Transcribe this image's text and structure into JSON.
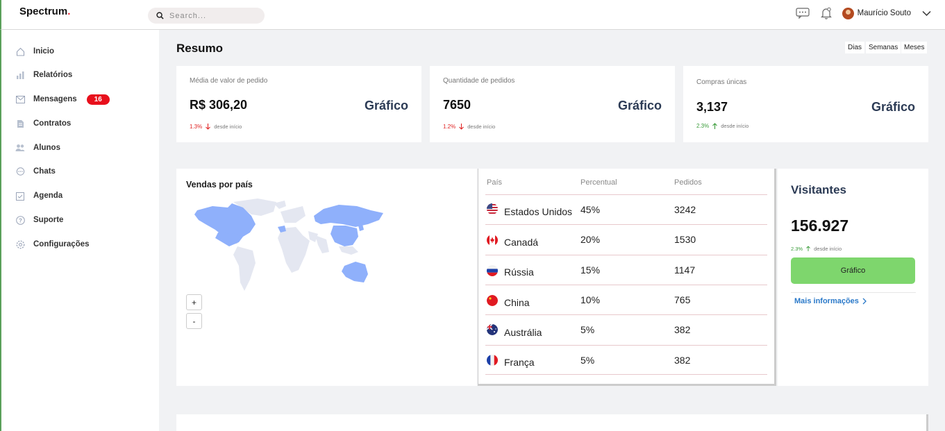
{
  "app": {
    "logo": "Spectrum",
    "logo_dot": "."
  },
  "search": {
    "placeholder": "Search..."
  },
  "user": {
    "name": "Maurício Souto"
  },
  "sidebar": {
    "items": [
      {
        "label": "Inicio",
        "icon": "home-icon"
      },
      {
        "label": "Relatórios",
        "icon": "chart-icon"
      },
      {
        "label": "Mensagens",
        "icon": "mail-icon",
        "badge": "16"
      },
      {
        "label": "Contratos",
        "icon": "document-icon"
      },
      {
        "label": "Alunos",
        "icon": "users-icon"
      },
      {
        "label": "Chats",
        "icon": "chat-icon"
      },
      {
        "label": "Agenda",
        "icon": "calendar-icon"
      },
      {
        "label": "Suporte",
        "icon": "help-icon"
      },
      {
        "label": "Configurações",
        "icon": "settings-icon"
      }
    ]
  },
  "main": {
    "title": "Resumo",
    "ranges": [
      "Dias",
      "Semanas",
      "Meses"
    ],
    "kpis": [
      {
        "label": "Média de valor de pedido",
        "value": "R$ 306,20",
        "link": "Gráfico",
        "change": "1.3%",
        "direction": "down",
        "since": "desde início"
      },
      {
        "label": "Quantidade de pedidos",
        "value": "7650",
        "link": "Gráfico",
        "change": "1.2%",
        "direction": "down",
        "since": "desde início"
      },
      {
        "label": "Compras únicas",
        "value": "3,137",
        "link": "Gráfico",
        "change": "2.3%",
        "direction": "up",
        "since": "desde início"
      }
    ]
  },
  "map": {
    "title": "Vendas por país",
    "zoom_in": "+",
    "zoom_out": "-"
  },
  "table": {
    "headers": [
      "País",
      "Percentual",
      "Pedidos"
    ],
    "rows": [
      {
        "country": "Estados Unidos",
        "percent": "45%",
        "orders": "3242",
        "flag": "flag-us-icon"
      },
      {
        "country": "Canadá",
        "percent": "20%",
        "orders": "1530",
        "flag": "flag-ca-icon"
      },
      {
        "country": "Rússia",
        "percent": "15%",
        "orders": "1147",
        "flag": "flag-ru-icon"
      },
      {
        "country": "China",
        "percent": "10%",
        "orders": "765",
        "flag": "flag-cn-icon"
      },
      {
        "country": "Austrália",
        "percent": "5%",
        "orders": "382",
        "flag": "flag-au-icon"
      },
      {
        "country": "França",
        "percent": "5%",
        "orders": "382",
        "flag": "flag-fr-icon"
      }
    ]
  },
  "visitors": {
    "title": "Visitantes",
    "value": "156.927",
    "change": "2.3%",
    "since": "desde início",
    "button": "Gráfico",
    "more": "Mais informações"
  },
  "colors": {
    "accent_green": "#7ed66d",
    "badge_red": "#e8101c",
    "map_highlight": "#8fb0fb",
    "map_base": "#e4e7f1"
  }
}
